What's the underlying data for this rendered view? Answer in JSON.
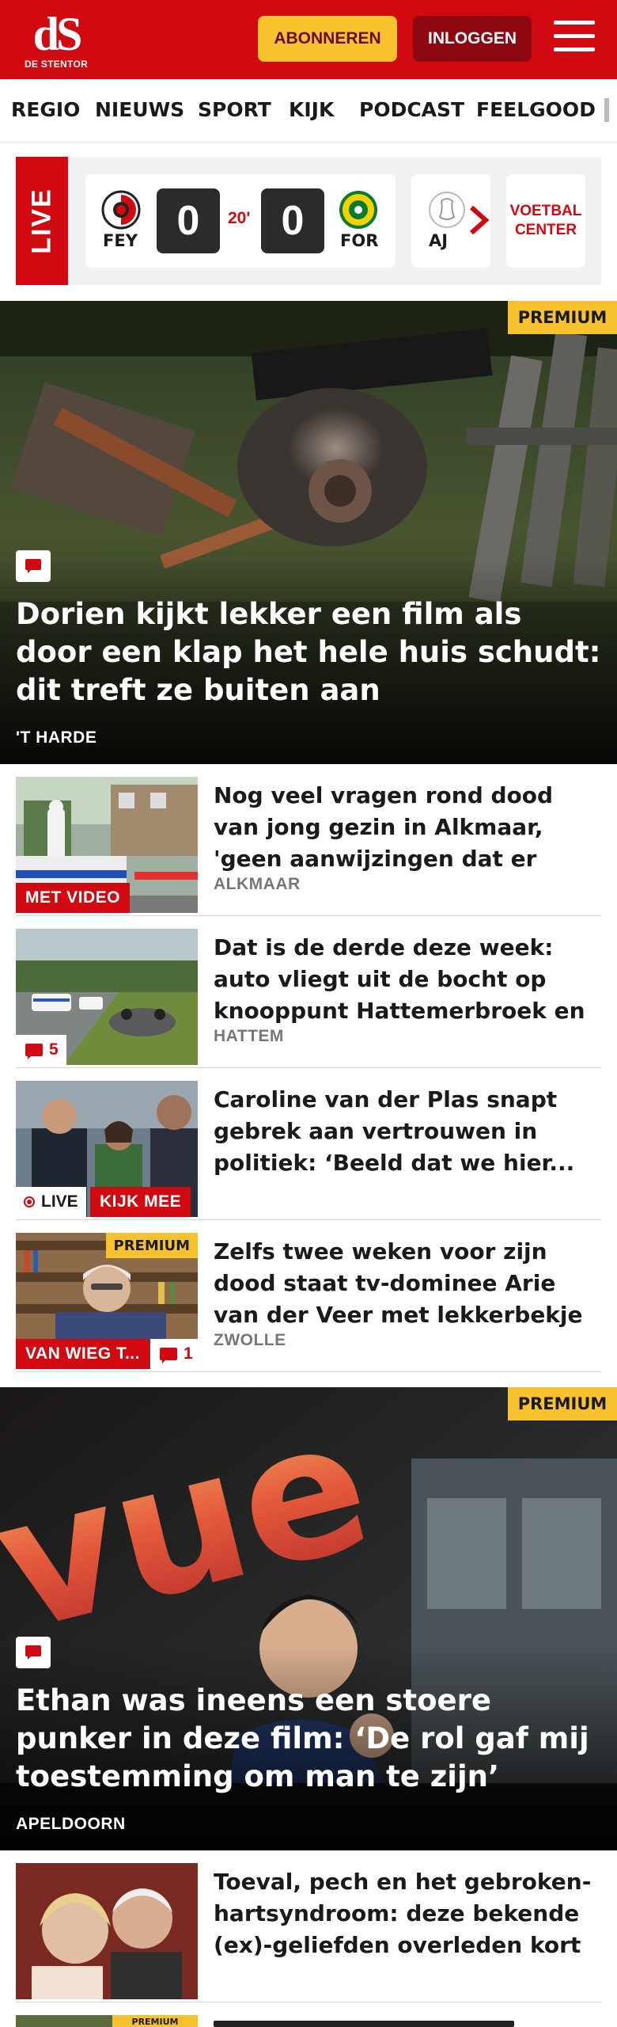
{
  "header": {
    "logo_mark": "dS",
    "logo_sub": "DE STENTOR",
    "subscribe_label": "ABONNEREN",
    "login_label": "INLOGGEN"
  },
  "nav": {
    "items": [
      "REGIO",
      "NIEUWS",
      "SPORT",
      "KIJK",
      "PODCAST",
      "FEELGOOD"
    ]
  },
  "live": {
    "label": "LIVE",
    "match": {
      "home": "FEY",
      "away": "FOR",
      "home_score": "0",
      "away_score": "0",
      "minute": "20'"
    },
    "next_match_team": "AJ",
    "voetbal_center": "VOETBAL CENTER"
  },
  "hero1": {
    "premium": "PREMIUM",
    "title": "Dorien kijkt lekker een film als door een klap het hele huis schudt: dit treft ze buiten aan",
    "location": "'T HARDE"
  },
  "articles": [
    {
      "title": "Nog veel vragen rond dood van jong gezin in Alkmaar, 'geen aanwijzingen dat er anderen bij...",
      "location": "ALKMAAR",
      "tag": "MET VIDEO"
    },
    {
      "title": "Dat is de derde deze week: auto vliegt uit de bocht op knooppunt Hattemerbroek en belandt op d...",
      "location": "HATTEM",
      "comments": "5"
    },
    {
      "title": "Caroline van der Plas snapt gebrek aan vertrouwen in politiek: ‘Beeld dat we hier...",
      "live_label": "LIVE",
      "tag": "KIJK MEE"
    },
    {
      "title": "Zelfs twee weken voor zijn dood staat tv-dominee Arie van der Veer met lekkerbekje voor de...",
      "location": "ZWOLLE",
      "premium": "PREMIUM",
      "tag": "VAN WIEG T...",
      "comments": "1"
    }
  ],
  "hero2": {
    "premium": "PREMIUM",
    "sign_text": "vue",
    "title": "Ethan was ineens een stoere punker in deze film: ‘De rol gaf mij toestemming om man te zijn’",
    "location": "APELDOORN"
  },
  "article5": {
    "title": "Toeval, pech en het gebroken-hartsyndroom: deze bekende (ex)-geliefden overleden kort na...",
    "premium": "PREMIUM"
  },
  "colors": {
    "brand_red": "#d10a11",
    "premium_yellow": "#f7c22d",
    "login_dark_red": "#8e0812"
  }
}
